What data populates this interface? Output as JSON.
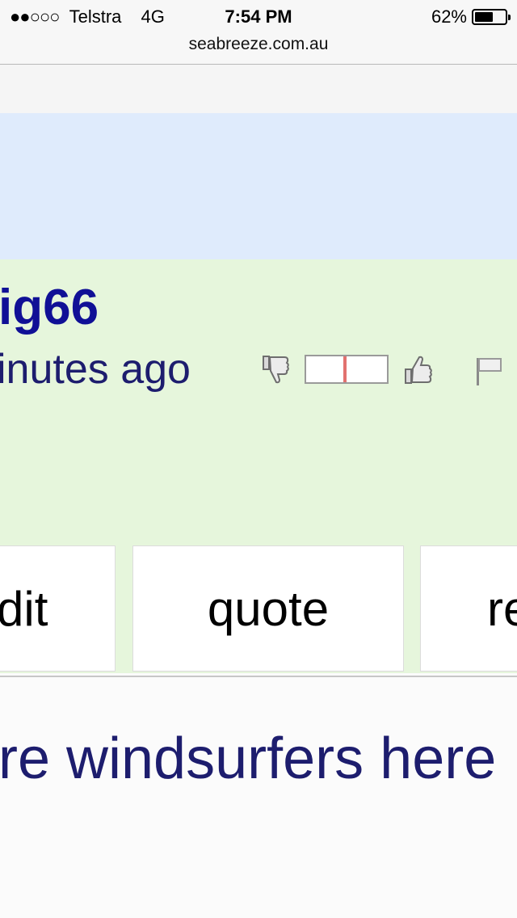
{
  "status": {
    "signal_dots": "●●○○○",
    "carrier": "Telstra",
    "network": "4G",
    "time": "7:54 PM",
    "battery": "62%",
    "battery_level": 0.62
  },
  "browser": {
    "url": "seabreeze.com.au"
  },
  "post": {
    "username": "ig66",
    "time_ago": "inutes ago",
    "vote_mark": 0.46,
    "icons": {
      "thumb_down": "thumbs-down-icon",
      "thumb_up": "thumbs-up-icon",
      "flag": "flag-icon"
    }
  },
  "actions": {
    "edit_label": "dit",
    "quote_label": "quote",
    "reply_label": "re"
  },
  "content": {
    "body_text": "re windsurfers here"
  }
}
